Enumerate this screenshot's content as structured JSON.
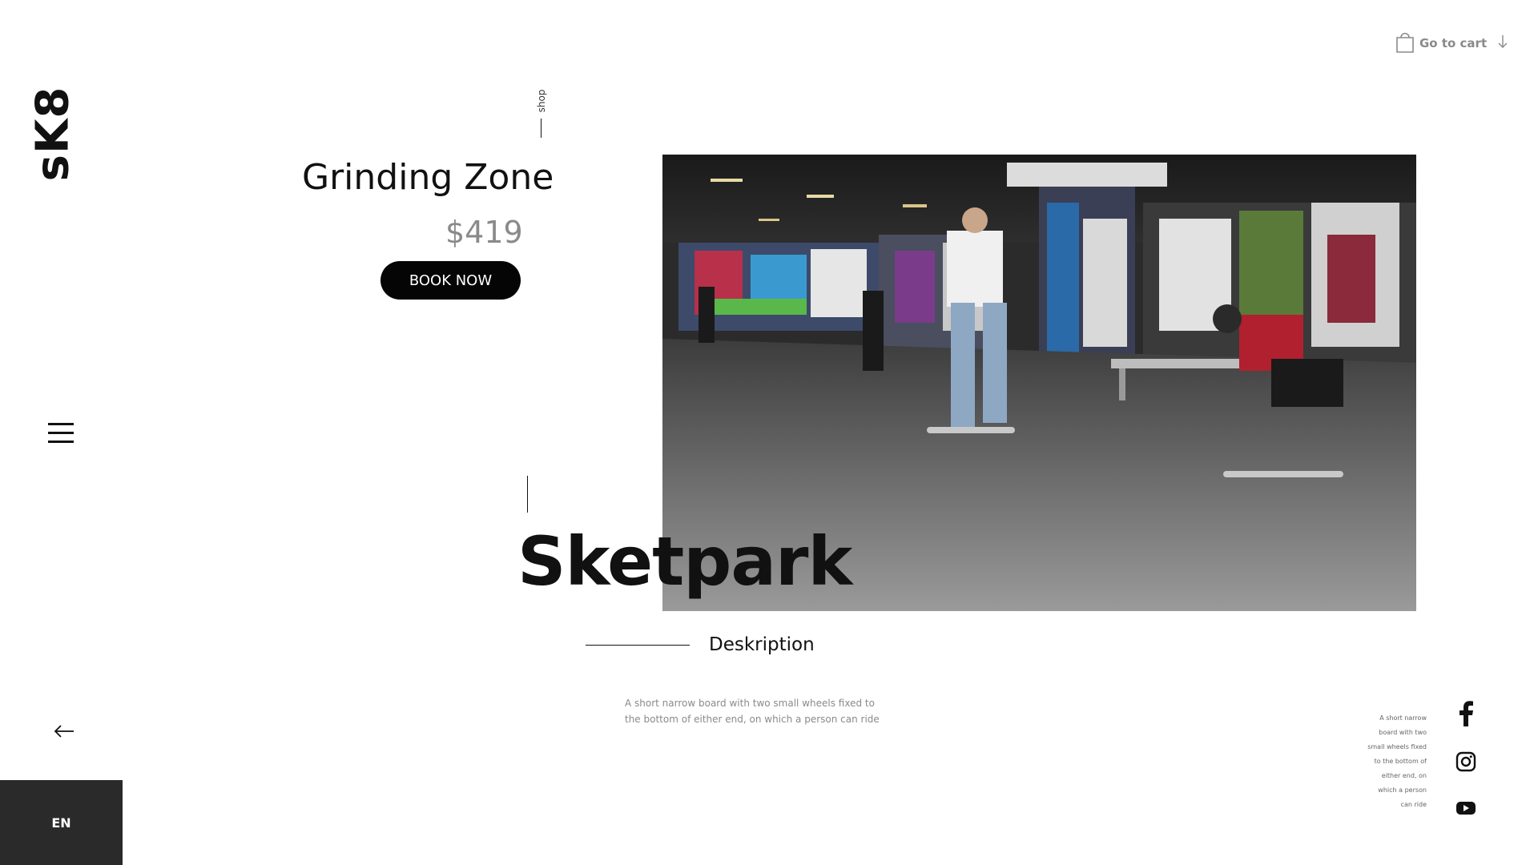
{
  "brand": {
    "logo_text": "sK8"
  },
  "nav": {
    "shop_label": "shop",
    "language_label": "EN"
  },
  "product": {
    "title": "Grinding Zone",
    "price": "$419",
    "cta_label": "BOOK NOW"
  },
  "cart": {
    "label": "Go to cart"
  },
  "hero": {
    "headline": "Sketpark"
  },
  "description": {
    "heading": "Deskription",
    "text": "A short narrow board with two small wheels fixed to the bottom of either end, on which a person can ride"
  },
  "side_note": {
    "text": "A short narrow board with two small wheels fixed to the bottom of either end, on which a person can ride"
  },
  "icons": {
    "menu": "hamburger-menu-icon",
    "back": "arrow-left-icon",
    "cart": "shopping-bag-icon",
    "cart_arrow": "arrow-down-icon",
    "facebook": "facebook-icon",
    "instagram": "instagram-icon",
    "youtube": "youtube-icon"
  },
  "colors": {
    "text": "#111111",
    "muted": "#8a8a8a",
    "button_bg": "#050505",
    "lang_bg": "#2a2a2a"
  }
}
